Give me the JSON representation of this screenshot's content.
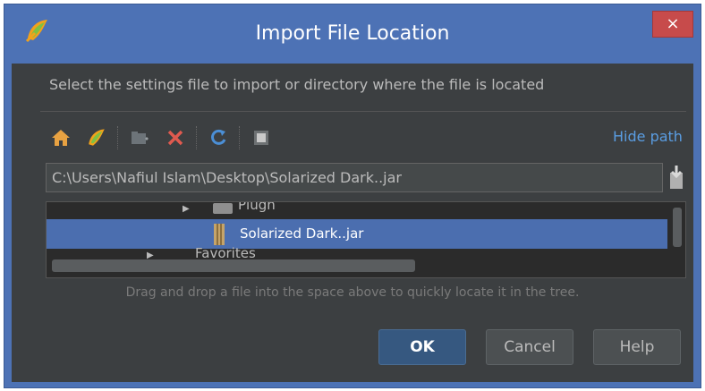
{
  "window": {
    "title": "Import File Location",
    "close_glyph": "×"
  },
  "prompt": "Select the settings file to import or directory where the file is located",
  "toolbar": {
    "icons": [
      "home-icon",
      "app-logo-icon",
      "new-folder-icon",
      "delete-icon",
      "refresh-icon",
      "show-hidden-icon"
    ],
    "hide_path_label": "Hide path"
  },
  "path_field": {
    "value": "C:\\Users\\Nafiul Islam\\Desktop\\Solarized Dark..jar"
  },
  "tree": {
    "partial_top_label": "Plugh",
    "selected_label": "Solarized Dark..jar",
    "partial_bottom_label": "Favorites"
  },
  "hint": "Drag and drop a file into the space above to quickly locate it in the tree.",
  "buttons": {
    "ok": "OK",
    "cancel": "Cancel",
    "help": "Help"
  },
  "colors": {
    "title_bar": "#4d72b5",
    "dialog_bg": "#3c3f41",
    "selection": "#4b6eaf",
    "link": "#5a9de2",
    "close_button": "#c74b4b"
  }
}
